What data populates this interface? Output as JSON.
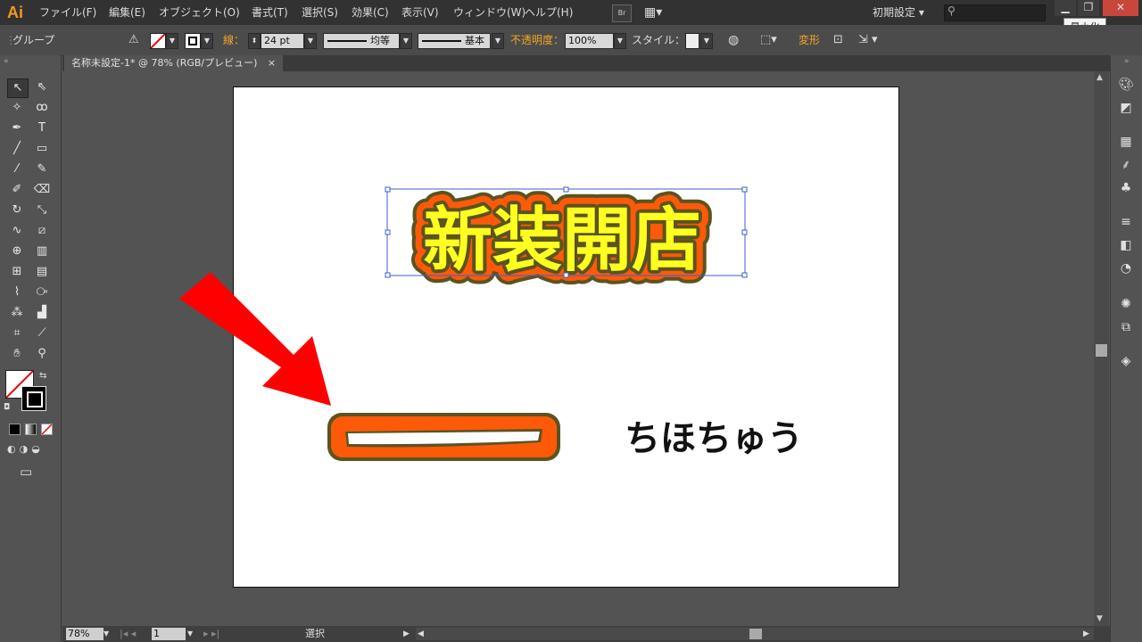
{
  "app": {
    "logo": "Ai",
    "workspace": "初期設定",
    "tooltip": "最小化"
  },
  "menu": [
    "ファイル(F)",
    "編集(E)",
    "オブジェクト(O)",
    "書式(T)",
    "選択(S)",
    "効果(C)",
    "表示(V)",
    "ウィンドウ(W)",
    "ヘルプ(H)"
  ],
  "bridge_label": "Br",
  "control": {
    "selection_label": "グループ",
    "stroke_label": "線：",
    "stroke_weight": "24 pt",
    "profile1": "均等",
    "profile2": "基本",
    "opacity_label": "不透明度：",
    "opacity": "100%",
    "style_label": "スタイル：",
    "transform_label": "変形"
  },
  "document": {
    "tab": "名称未設定-1* @ 78% (RGB/プレビュー)",
    "close": "×"
  },
  "artwork": {
    "headline": "新装開店",
    "caption": "ちほちゅう",
    "colors": {
      "orange": "#fc5a09",
      "olive": "#5b5320",
      "yellow": "#ffff20",
      "arrow": "#ff0000",
      "selection": "#3a5fd0"
    }
  },
  "status": {
    "zoom": "78%",
    "page": "1",
    "mode": "選択"
  },
  "icons": [
    "selection-tool-icon",
    "direct-selection-tool-icon",
    "magic-wand-icon",
    "lasso-icon",
    "pen-icon",
    "type-tool-icon",
    "line-tool-icon",
    "rectangle-tool-icon",
    "paintbrush-icon",
    "pencil-icon",
    "blob-brush-icon",
    "eraser-icon",
    "rotate-icon",
    "scale-icon",
    "warp-icon",
    "free-transform-icon",
    "shape-builder-icon",
    "perspective-icon",
    "mesh-icon",
    "gradient-icon",
    "eyedropper-icon",
    "blend-icon",
    "symbol-sprayer-icon",
    "graph-icon",
    "artboard-icon",
    "slice-icon",
    "hand-icon",
    "zoom-icon"
  ]
}
